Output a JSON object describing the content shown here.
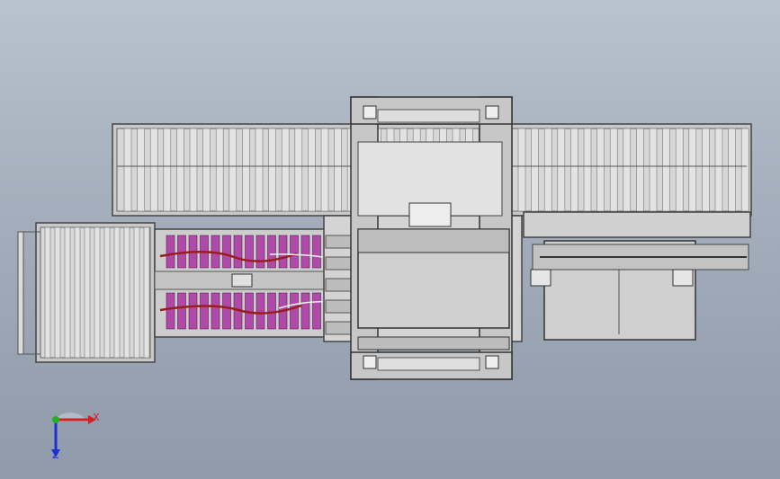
{
  "viewport": {
    "background_top": "#b9c2cf",
    "background_bottom": "#8f9aaa"
  },
  "model": {
    "frame_color": "#c9c9c9",
    "roller_color": "#e3e3e3",
    "tray_color": "#b04aa8",
    "cable_color": "#9b1c1c",
    "housing_color": "#cfcfcf",
    "outline_color": "#333333",
    "icons": [
      "conveyor-roller-icon",
      "pallet-tray-icon",
      "gantry-frame-icon",
      "cable-icon"
    ]
  },
  "triad": {
    "x_label": "X",
    "z_label": "Z",
    "x_color": "#d32020",
    "y_color": "#20b020",
    "z_color": "#2030d0"
  }
}
